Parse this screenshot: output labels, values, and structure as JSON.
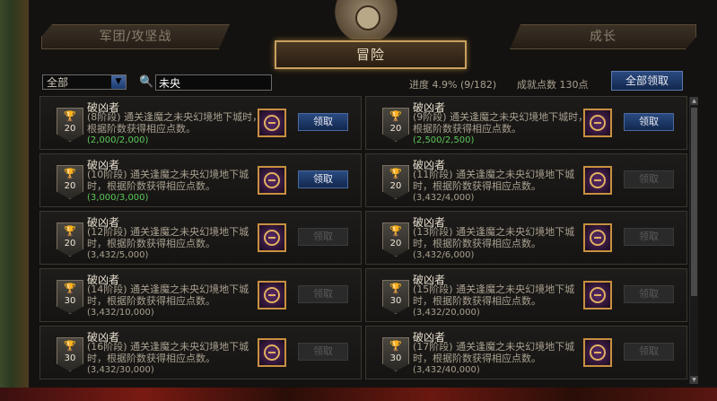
{
  "tabs": {
    "left": "军团/攻坚战",
    "center": "冒险",
    "right": "成长"
  },
  "filter": {
    "category": "全部",
    "search_value": "未央"
  },
  "summary": {
    "progress": "进度  4.9% (9/182)",
    "points": "成就点数 130点",
    "claim_all": "全部领取"
  },
  "achievements": [
    {
      "title": "破凶者",
      "desc": "(8阶段) 通关逢魔之未央幻境地下城时，根据阶数获得相应点数。",
      "progress": "(2,000/2,000)",
      "points": "20",
      "done": true,
      "button": "领取",
      "button_enabled": true
    },
    {
      "title": "破凶者",
      "desc": "(9阶段) 通关逢魔之未央幻境地下城时，根据阶数获得相应点数。",
      "progress": "(2,500/2,500)",
      "points": "20",
      "done": true,
      "button": "领取",
      "button_enabled": true
    },
    {
      "title": "破凶者",
      "desc": "(10阶段) 通关逢魔之未央幻境地下城时，根据阶数获得相应点数。",
      "progress": "(3,000/3,000)",
      "points": "20",
      "done": true,
      "button": "领取",
      "button_enabled": true
    },
    {
      "title": "破凶者",
      "desc": "(11阶段) 通关逢魔之未央幻境地下城时，根据阶数获得相应点数。",
      "progress": "(3,432/4,000)",
      "points": "20",
      "done": false,
      "button": "领取",
      "button_enabled": false
    },
    {
      "title": "破凶者",
      "desc": "(12阶段) 通关逢魔之未央幻境地下城时，根据阶数获得相应点数。",
      "progress": "(3,432/5,000)",
      "points": "20",
      "done": false,
      "button": "领取",
      "button_enabled": false
    },
    {
      "title": "破凶者",
      "desc": "(13阶段) 通关逢魔之未央幻境地下城时，根据阶数获得相应点数。",
      "progress": "(3,432/6,000)",
      "points": "20",
      "done": false,
      "button": "领取",
      "button_enabled": false
    },
    {
      "title": "破凶者",
      "desc": "(14阶段) 通关逢魔之未央幻境地下城时，根据阶数获得相应点数。",
      "progress": "(3,432/10,000)",
      "points": "30",
      "done": false,
      "button": "领取",
      "button_enabled": false
    },
    {
      "title": "破凶者",
      "desc": "(15阶段) 通关逢魔之未央幻境地下城时，根据阶数获得相应点数。",
      "progress": "(3,432/20,000)",
      "points": "30",
      "done": false,
      "button": "领取",
      "button_enabled": false
    },
    {
      "title": "破凶者",
      "desc": "(16阶段) 通关逢魔之未央幻境地下城时，根据阶数获得相应点数。",
      "progress": "(3,432/30,000)",
      "points": "30",
      "done": false,
      "button": "领取",
      "button_enabled": false
    },
    {
      "title": "破凶者",
      "desc": "(17阶段) 通关逢魔之未央幻境地下城时，根据阶数获得相应点数。",
      "progress": "(3,432/40,000)",
      "points": "30",
      "done": false,
      "button": "领取",
      "button_enabled": false
    }
  ]
}
